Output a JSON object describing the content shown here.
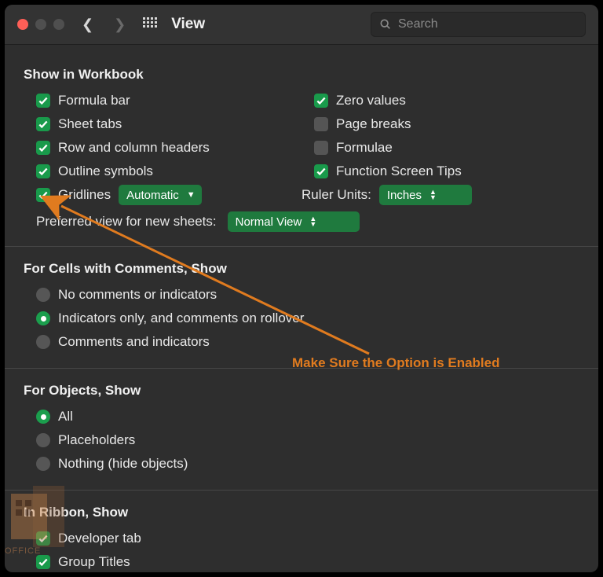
{
  "toolbar": {
    "title": "View",
    "search_placeholder": "Search"
  },
  "section1": {
    "title": "Show in Workbook",
    "left": {
      "formula_bar": "Formula bar",
      "sheet_tabs": "Sheet tabs",
      "row_col_headers": "Row and column headers",
      "outline_symbols": "Outline symbols",
      "gridlines": "Gridlines",
      "gridlines_dropdown": "Automatic"
    },
    "right": {
      "zero_values": "Zero values",
      "page_breaks": "Page breaks",
      "formulae": "Formulae",
      "function_tips": "Function Screen Tips",
      "ruler_units_label": "Ruler Units:",
      "ruler_units_value": "Inches"
    },
    "preferred_view_label": "Preferred view for new sheets:",
    "preferred_view_value": "Normal View"
  },
  "section2": {
    "title": "For Cells with Comments, Show",
    "opt1": "No comments or indicators",
    "opt2": "Indicators only, and comments on rollover",
    "opt3": "Comments and indicators"
  },
  "section3": {
    "title": "For Objects, Show",
    "opt1": "All",
    "opt2": "Placeholders",
    "opt3": "Nothing (hide objects)"
  },
  "section4": {
    "title": "In Ribbon, Show",
    "opt1": "Developer tab",
    "opt2": "Group Titles"
  },
  "annotation": "Make Sure the Option is Enabled",
  "watermark": "OFFICE"
}
